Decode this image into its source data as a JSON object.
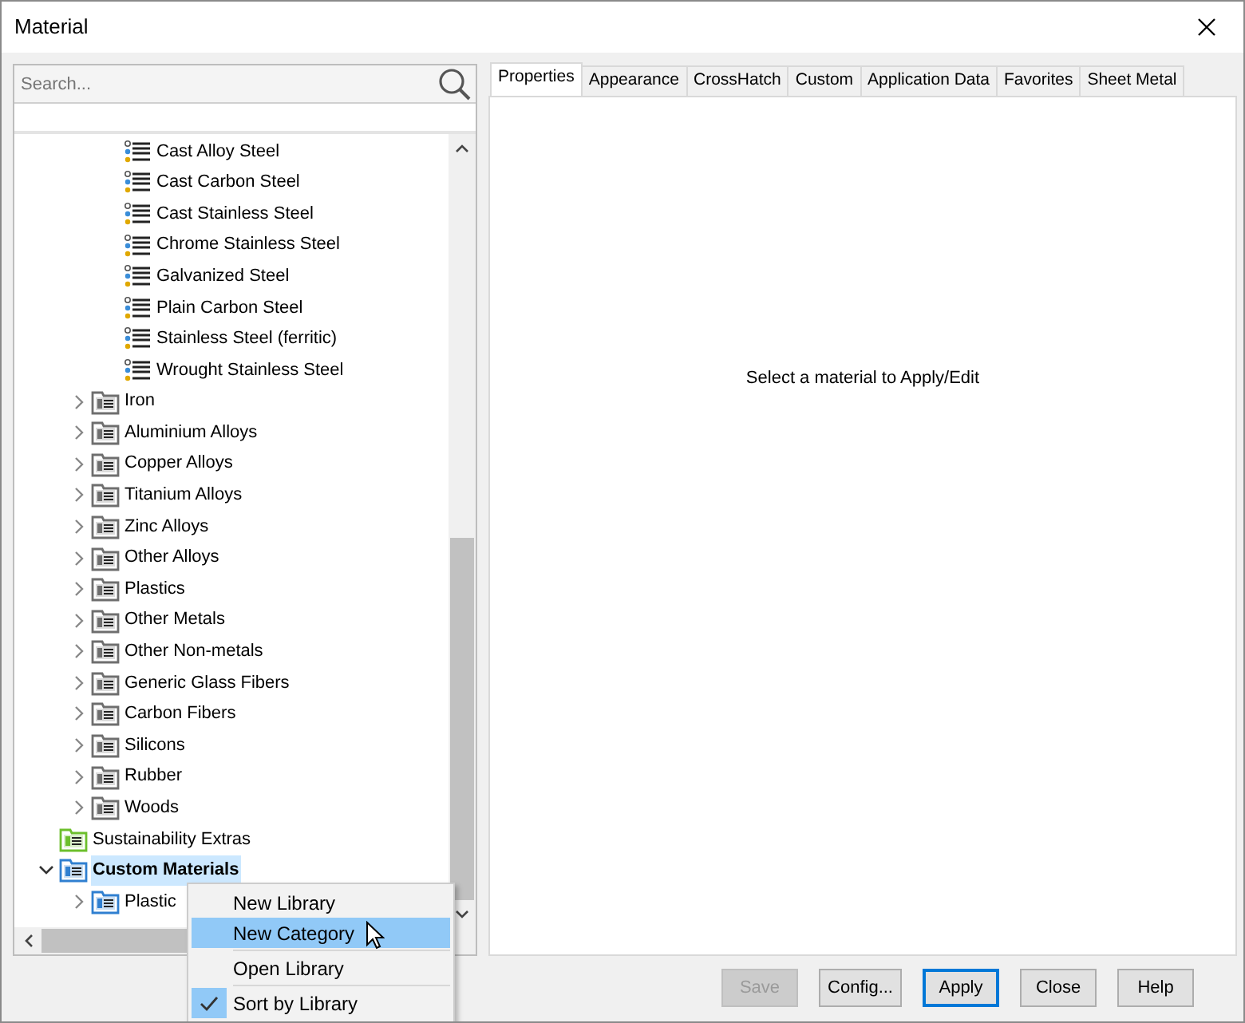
{
  "window": {
    "title": "Material"
  },
  "search": {
    "placeholder": "Search..."
  },
  "tree": {
    "items": [
      {
        "children": [
          {
            "children": [
              {
                "kind": "material",
                "label": "Cast Alloy Steel"
              },
              {
                "kind": "material",
                "label": "Cast Carbon Steel"
              },
              {
                "kind": "material",
                "label": "Cast Stainless Steel"
              },
              {
                "kind": "material",
                "label": "Chrome Stainless Steel"
              },
              {
                "kind": "material",
                "label": "Galvanized Steel"
              },
              {
                "kind": "material",
                "label": "Plain Carbon Steel"
              },
              {
                "kind": "material",
                "label": "Stainless Steel (ferritic)"
              },
              {
                "kind": "material",
                "label": "Wrought Stainless Steel"
              }
            ]
          },
          {
            "kind": "folder",
            "label": "Iron",
            "expanded": false,
            "selected": false,
            "color": "#6e6e6e"
          },
          {
            "kind": "folder",
            "label": "Aluminium Alloys",
            "expanded": false,
            "selected": false,
            "color": "#6e6e6e"
          },
          {
            "kind": "folder",
            "label": "Copper Alloys",
            "expanded": false,
            "selected": false,
            "color": "#6e6e6e"
          },
          {
            "kind": "folder",
            "label": "Titanium Alloys",
            "expanded": false,
            "selected": false,
            "color": "#6e6e6e"
          },
          {
            "kind": "folder",
            "label": "Zinc Alloys",
            "expanded": false,
            "selected": false,
            "color": "#6e6e6e"
          },
          {
            "kind": "folder",
            "label": "Other Alloys",
            "expanded": false,
            "selected": false,
            "color": "#6e6e6e"
          },
          {
            "kind": "folder",
            "label": "Plastics",
            "expanded": false,
            "selected": false,
            "color": "#6e6e6e"
          },
          {
            "kind": "folder",
            "label": "Other Metals",
            "expanded": false,
            "selected": false,
            "color": "#6e6e6e"
          },
          {
            "kind": "folder",
            "label": "Other Non-metals",
            "expanded": false,
            "selected": false,
            "color": "#6e6e6e"
          },
          {
            "kind": "folder",
            "label": "Generic Glass Fibers",
            "expanded": false,
            "selected": false,
            "color": "#6e6e6e"
          },
          {
            "kind": "folder",
            "label": "Carbon Fibers",
            "expanded": false,
            "selected": false,
            "color": "#6e6e6e"
          },
          {
            "kind": "folder",
            "label": "Silicons",
            "expanded": false,
            "selected": false,
            "color": "#6e6e6e"
          },
          {
            "kind": "folder",
            "label": "Rubber",
            "expanded": false,
            "selected": false,
            "color": "#6e6e6e"
          },
          {
            "kind": "folder",
            "label": "Woods",
            "expanded": false,
            "selected": false,
            "color": "#6e6e6e"
          }
        ]
      },
      {
        "kind": "folder",
        "label": "Sustainability Extras",
        "selected": false,
        "color": "#6cbf2c"
      },
      {
        "kind": "folder",
        "label": "Custom Materials",
        "expanded": true,
        "selected": true,
        "color": "#2f7fd0",
        "children": [
          {
            "kind": "folder",
            "label": "Plastic",
            "expanded": false,
            "selected": false,
            "color": "#2f7fd0"
          }
        ]
      }
    ]
  },
  "context_menu": {
    "items": [
      {
        "kind": "item",
        "label": "New Library",
        "highlighted": false,
        "checked": false
      },
      {
        "kind": "item",
        "label": "New Category",
        "highlighted": true,
        "checked": false
      },
      {
        "kind": "separator"
      },
      {
        "kind": "item",
        "label": "Open Library",
        "highlighted": false,
        "checked": false
      },
      {
        "kind": "separator"
      },
      {
        "kind": "item",
        "label": "Sort by Library",
        "highlighted": false,
        "checked": true
      }
    ]
  },
  "tabs": [
    {
      "label": "Properties",
      "selected": true
    },
    {
      "label": "Appearance",
      "selected": false
    },
    {
      "label": "CrossHatch",
      "selected": false
    },
    {
      "label": "Custom",
      "selected": false
    },
    {
      "label": "Application Data",
      "selected": false
    },
    {
      "label": "Favorites",
      "selected": false
    },
    {
      "label": "Sheet Metal",
      "selected": false
    }
  ],
  "message": "Select a material to Apply/Edit",
  "buttons": [
    {
      "label": "Save",
      "disabled": true,
      "default": false
    },
    {
      "label": "Config...",
      "disabled": false,
      "default": false
    },
    {
      "label": "Apply",
      "disabled": false,
      "default": true
    },
    {
      "label": "Close",
      "disabled": false,
      "default": false
    },
    {
      "label": "Help",
      "disabled": false,
      "default": false
    }
  ]
}
